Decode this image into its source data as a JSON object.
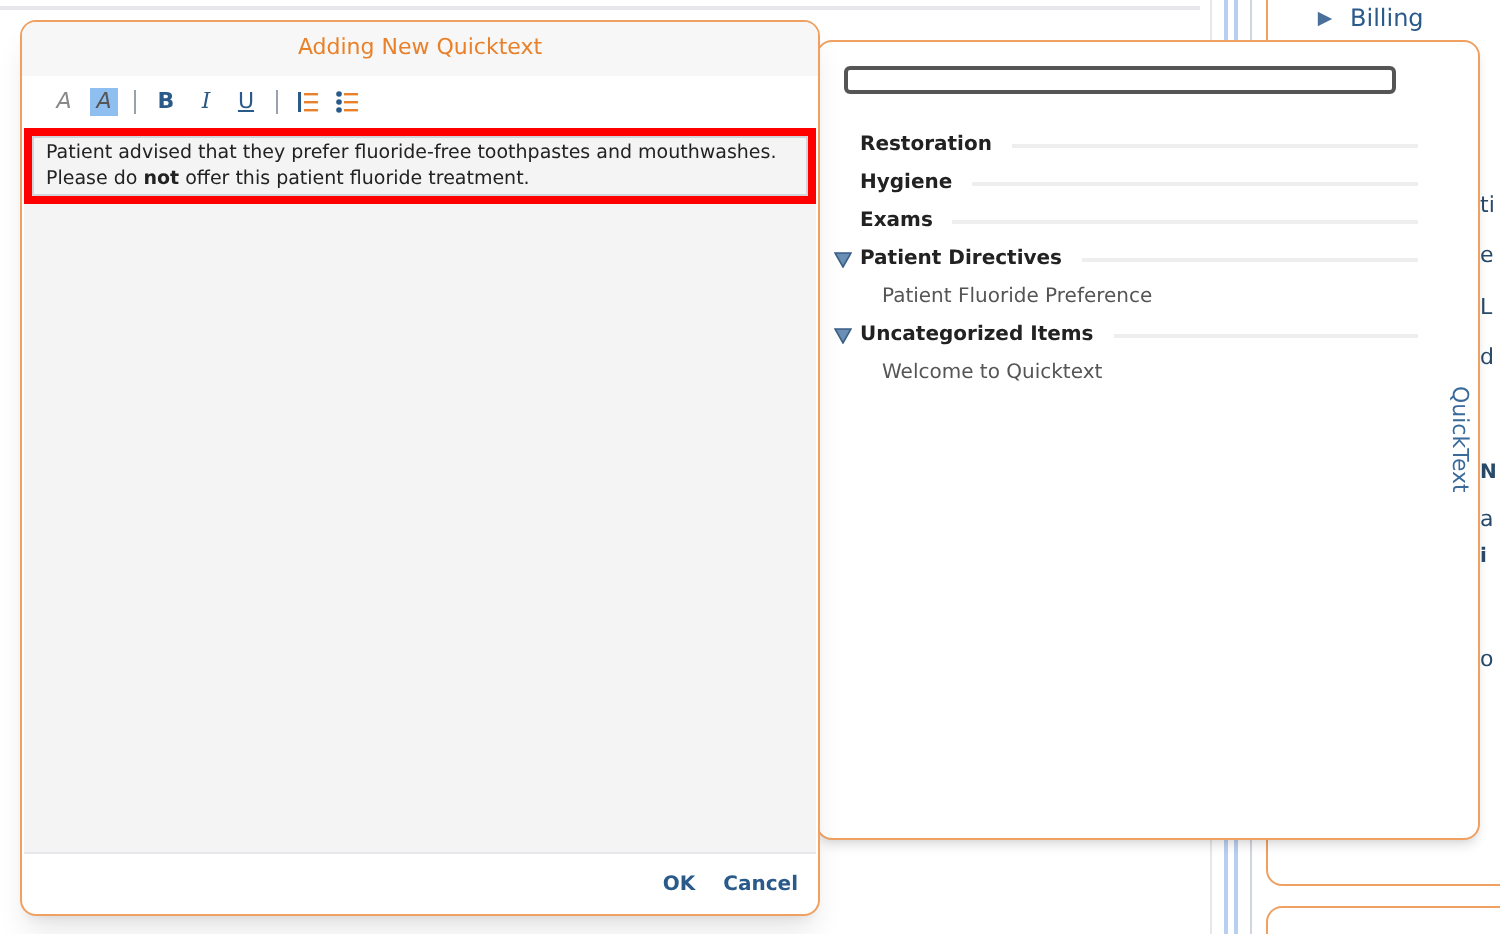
{
  "background": {
    "nav_item": "Billing",
    "fragments": [
      {
        "text": "ti",
        "bold": false
      },
      {
        "text": "e",
        "bold": false
      },
      {
        "text": "L",
        "bold": false
      },
      {
        "text": "d",
        "bold": false
      },
      {
        "text": "N",
        "bold": true
      },
      {
        "text": "a",
        "bold": false
      },
      {
        "text": "i",
        "bold": true
      },
      {
        "text": "o",
        "bold": false
      }
    ]
  },
  "quicktext_panel": {
    "tab_label": "QuickText",
    "categories": [
      {
        "name": "Restoration",
        "expanded": false
      },
      {
        "name": "Hygiene",
        "expanded": false
      },
      {
        "name": "Exams",
        "expanded": false
      },
      {
        "name": "Patient Directives",
        "expanded": true,
        "children": [
          "Patient Fluoride Preference"
        ]
      },
      {
        "name": "Uncategorized Items",
        "expanded": true,
        "children": [
          "Welcome to Quicktext"
        ]
      }
    ]
  },
  "dialog": {
    "title": "Adding New Quicktext",
    "toolbar": [
      {
        "kind": "font-color",
        "label": "A",
        "selected": false
      },
      {
        "kind": "highlight",
        "label": "A",
        "selected": true
      },
      {
        "kind": "sep"
      },
      {
        "kind": "bold",
        "label": "B",
        "selected": false
      },
      {
        "kind": "italic",
        "label": "I",
        "selected": false
      },
      {
        "kind": "underline",
        "label": "U",
        "selected": false
      },
      {
        "kind": "sep"
      },
      {
        "kind": "numbered-list",
        "selected": false
      },
      {
        "kind": "bullet-list",
        "selected": false
      }
    ],
    "text_lines": [
      "Patient advised that they prefer fluoride-free toothpastes and mouthwashes.",
      "Please do **not** offer this patient fluoride treatment."
    ],
    "buttons": [
      "OK",
      "Cancel"
    ]
  }
}
